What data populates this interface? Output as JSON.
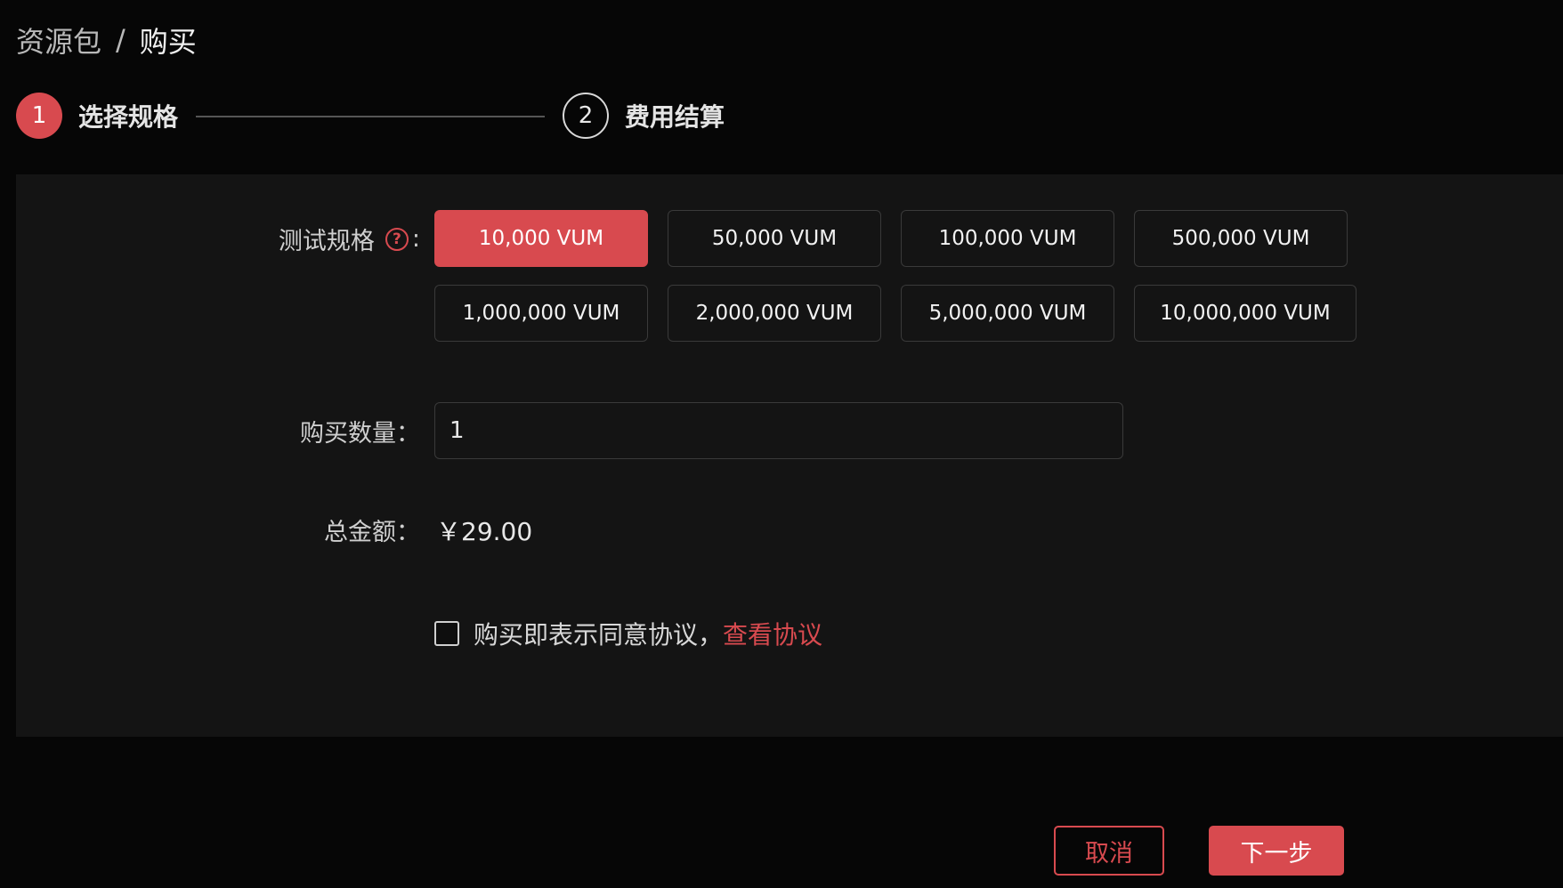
{
  "breadcrumb": {
    "parent": "资源包",
    "separator": "/",
    "current": "购买"
  },
  "steps": [
    {
      "number": "1",
      "label": "选择规格",
      "status": "active"
    },
    {
      "number": "2",
      "label": "费用结算",
      "status": "pending"
    }
  ],
  "form": {
    "spec": {
      "label": "测试规格",
      "help_icon": "?",
      "colon": ":",
      "options": [
        "10,000 VUM",
        "50,000 VUM",
        "100,000 VUM",
        "500,000 VUM",
        "1,000,000 VUM",
        "2,000,000 VUM",
        "5,000,000 VUM",
        "10,000,000 VUM"
      ],
      "selected": "10,000 VUM"
    },
    "quantity": {
      "label": "购买数量：",
      "value": "1"
    },
    "total": {
      "label": "总金额：",
      "value": "￥29.00"
    },
    "agreement": {
      "checked": false,
      "text": "购买即表示同意协议，",
      "link": "查看协议"
    }
  },
  "actions": {
    "cancel": "取消",
    "next": "下一步"
  },
  "colors": {
    "accent": "#d84a4f",
    "background": "#060606",
    "panel": "#141414"
  },
  "icons": {
    "help": "question-circle-icon",
    "checkbox": "checkbox-icon"
  }
}
